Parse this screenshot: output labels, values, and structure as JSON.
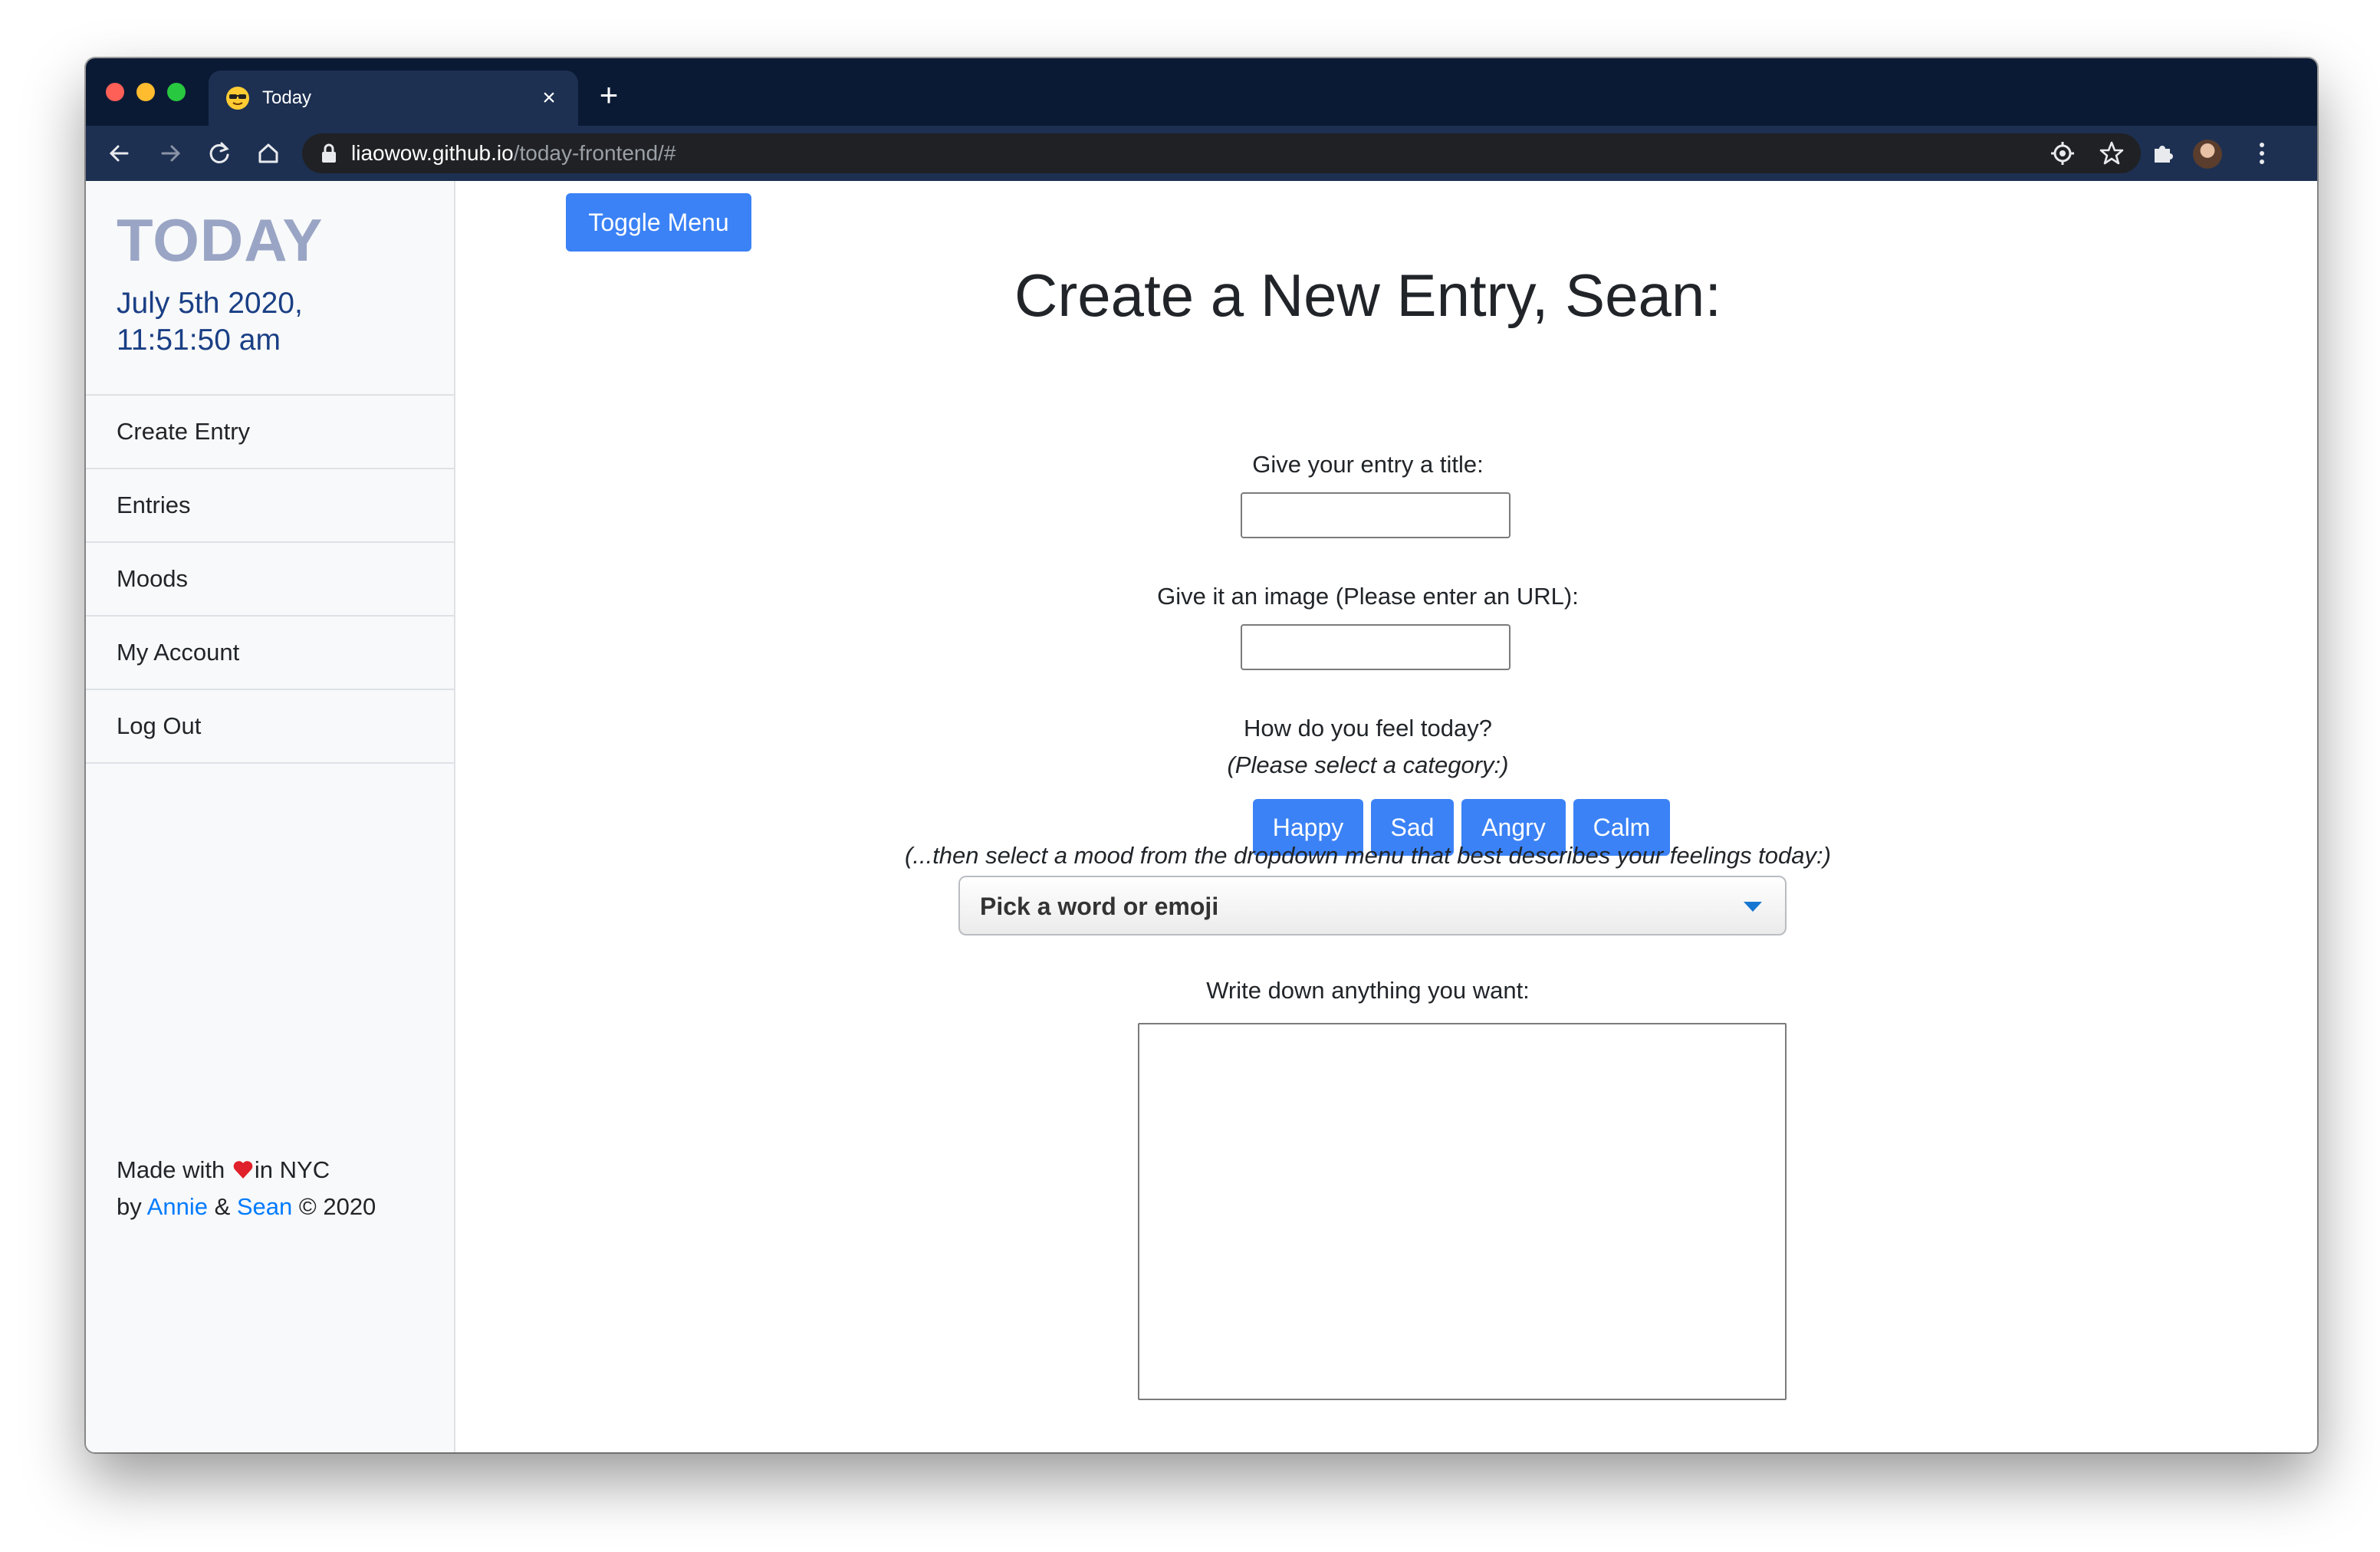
{
  "browser": {
    "tab_title": "Today",
    "favicon": "sunglasses-emoji-icon",
    "url_host": "liaowow.github.io",
    "url_path": "/today-frontend/#"
  },
  "sidebar": {
    "brand": "TODAY",
    "date_line1": "July 5th 2020,",
    "date_line2": "11:51:50 am",
    "menu": [
      "Create Entry",
      "Entries",
      "Moods",
      "My Account",
      "Log Out"
    ],
    "footer": {
      "made_with": "Made with ",
      "in_nyc": "in NYC",
      "by": "by ",
      "author1": "Annie",
      "amp": " & ",
      "author2": "Sean",
      "copyright": " © 2020"
    }
  },
  "main": {
    "toggle_label": "Toggle Menu",
    "heading": "Create a New Entry, Sean:",
    "title_label": "Give your entry a title:",
    "title_value": "",
    "image_label": "Give it an image (Please enter an URL):",
    "image_value": "",
    "feel_label": "How do you feel today?",
    "feel_hint": "(Please select a category:)",
    "categories": [
      "Happy",
      "Sad",
      "Angry",
      "Calm"
    ],
    "mood_hint": "(...then select a mood from the dropdown menu that best describes your feelings today:)",
    "mood_placeholder": "Pick a word or emoji",
    "notes_label": "Write down anything you want:",
    "notes_value": ""
  },
  "colors": {
    "primary_button": "#3b82f6",
    "brand_text": "#9aa5c5",
    "date_text": "#1a3f85",
    "link": "#007bff",
    "browser_chrome": "#0b1a34"
  }
}
